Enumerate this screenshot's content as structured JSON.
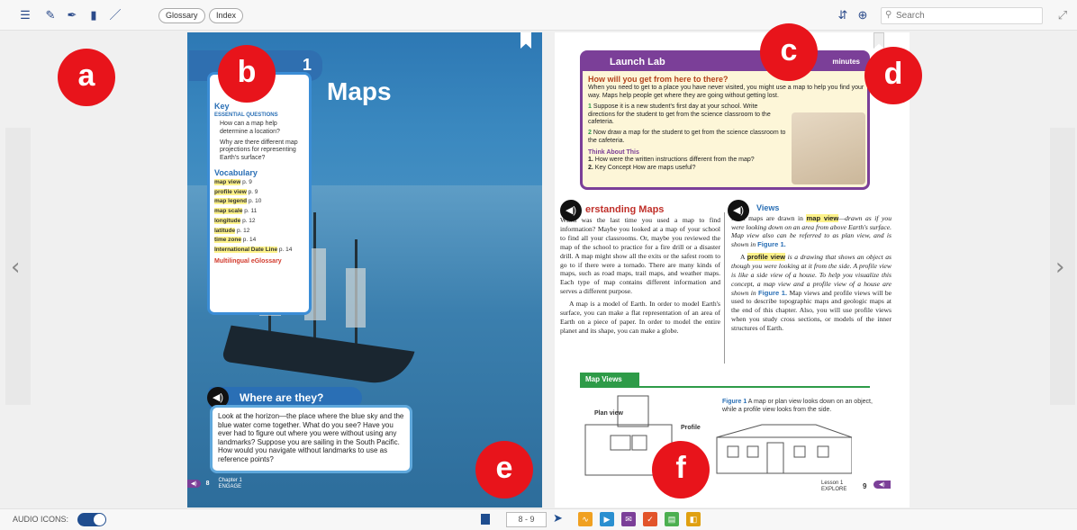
{
  "toolbar": {
    "glossary_label": "Glossary",
    "index_label": "Index",
    "search_placeholder": "Search"
  },
  "left_page": {
    "title": "Maps",
    "chapter_tab_label": "1",
    "big_idea_heading": "Key",
    "big_idea_heading_suffix": "de",
    "essential_questions_label": "ESSENTIAL QUESTIONS",
    "questions": [
      "How can a map help determine a location?",
      "Why are there different map projections for representing Earth's surface?"
    ],
    "vocab_heading": "Vocabulary",
    "vocab": [
      {
        "term": "map view",
        "page": "p. 9"
      },
      {
        "term": "profile view",
        "page": "p. 9"
      },
      {
        "term": "map legend",
        "page": "p. 10"
      },
      {
        "term": "map scale",
        "page": "p. 11"
      },
      {
        "term": "longitude",
        "page": "p. 12"
      },
      {
        "term": "latitude",
        "page": "p. 12"
      },
      {
        "term": "time zone",
        "page": "p. 14"
      },
      {
        "term": "International Date Line",
        "page": "p. 14"
      }
    ],
    "multilingual": "Multilingual eGlossary",
    "where_title": "Where are they?",
    "where_text": "Look at the horizon—the place where the blue sky and the blue water come together. What do you see? Have you ever had to figure out where you were without using any landmarks? Suppose you are sailing in the South Pacific. How would you navigate without landmarks to use as reference points?",
    "page_number": "8",
    "footer_chapter": "Chapter 1",
    "footer_section": "ENGAGE"
  },
  "right_page": {
    "launch_lab_title": "Launch Lab",
    "launch_lab_minutes": "minutes",
    "launch_question": "How will you get from here to there?",
    "launch_intro": "When you need to get to a place you have never visited, you might use a map to help you find your way. Maps help people get where they are going without getting lost.",
    "steps": [
      "Suppose it is a new student's first day at your school. Write directions for the student to get from the science classroom to the cafeteria.",
      "Now draw a map for the student to get from the science classroom to the cafeteria."
    ],
    "think_heading": "Think About This",
    "think_items": [
      "How were the written instructions different from the map?",
      "Key Concept How are maps useful?"
    ],
    "col1_heading": "erstanding Maps",
    "col1_p1": "When was the last time you used a map to find information? Maybe you looked at a map of your school to find all your classrooms. Or, maybe you reviewed the map of the school to practice for a fire drill or a disaster drill. A map might show all the exits or the safest room to go to if there were a tornado. There are many kinds of maps, such as road maps, trail maps, and weather maps. Each type of map contains different information and serves a different purpose.",
    "col1_p2": "A map is a model of Earth. In order to model Earth's surface, you can make a flat representation of an area of Earth on a piece of paper. In order to model the entire planet and its shape, you can make a globe.",
    "col2_heading": "Views",
    "col2_p1_a": "Most maps are drawn in",
    "col2_p1_hl": "map view",
    "col2_p1_b": "—drawn as if you were looking down on an area from above Earth's surface. Map view also can be referred to as plan view, and is shown in",
    "col2_p1_fig": "Figure 1.",
    "col2_p2_a": "A",
    "col2_p2_hl": "profile view",
    "col2_p2_b": "is a drawing that shows an object as though you were looking at it from the side. A profile view is like a side view of a house. To help you visualize this concept, a map view and a profile view of a house are shown in",
    "col2_p2_fig": "Figure 1.",
    "col2_p2_c": "Map views and profile views will be used to describe topographic maps and geologic maps at the end of this chapter. Also, you will use profile views when you study cross sections, or models of the inner structures of Earth.",
    "map_views_label": "Map Views",
    "figure_caption_bold": "Figure 1",
    "figure_caption": "A map or plan view looks down on an object, while a profile view looks from the side.",
    "plan_view_label": "Plan view",
    "profile_label": "Profile",
    "page_number": "9",
    "footer_lesson": "Lesson 1",
    "footer_section": "EXPLORE"
  },
  "labels": {
    "a": "a",
    "b": "b",
    "c": "c",
    "d": "d",
    "e": "e",
    "f": "f"
  },
  "bottombar": {
    "audio_label": "AUDIO ICONS:",
    "page_range": "8 - 9"
  },
  "colors": {
    "accent": "#1f4d8f",
    "label_red": "#e8141b",
    "launch_purple": "#7b3f98"
  }
}
